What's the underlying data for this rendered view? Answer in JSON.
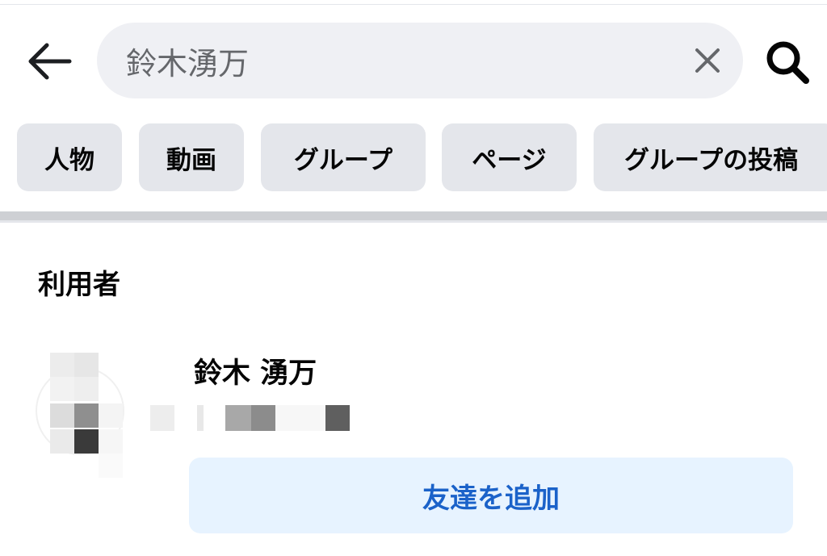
{
  "header": {
    "back_icon": "arrow-left-icon",
    "search": {
      "value": "鈴木湧万",
      "placeholder": "",
      "clear_icon": "close-icon"
    },
    "search_icon": "magnifier-icon"
  },
  "filters": [
    {
      "label": "人物"
    },
    {
      "label": "動画"
    },
    {
      "label": "グループ"
    },
    {
      "label": "ページ"
    },
    {
      "label": "グループの投稿"
    }
  ],
  "results": {
    "section_title": "利用者",
    "person": {
      "name": "鈴木 湧万",
      "subtitle_obscured": true,
      "add_friend_label": "友達を追加"
    }
  },
  "colors": {
    "search_bg": "#eff0f4",
    "chip_bg": "#e4e6eb",
    "button_bg": "#e7f3ff",
    "button_text": "#1b62c9"
  }
}
